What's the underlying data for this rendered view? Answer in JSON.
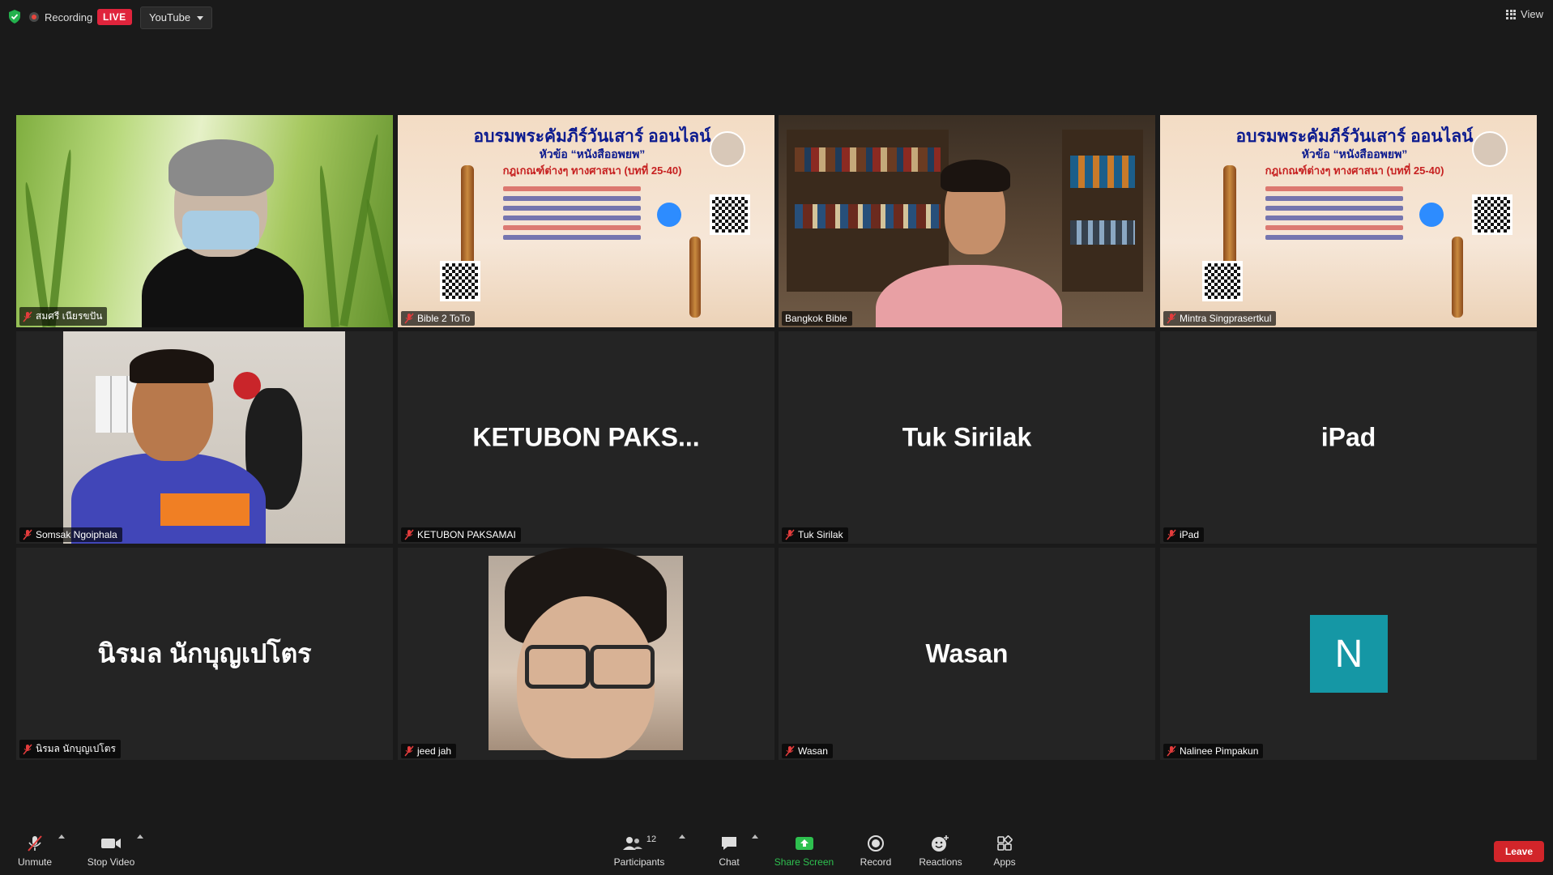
{
  "topbar": {
    "recording_label": "Recording",
    "live_label": "LIVE",
    "stream_target": "YouTube",
    "view_label": "View"
  },
  "tiles": [
    {
      "name": "สมศรี เนียรขปัน",
      "type": "video",
      "muted": true
    },
    {
      "name": "Bible 2 ToTo",
      "type": "share",
      "muted": true
    },
    {
      "name": "Bangkok Bible",
      "type": "video",
      "muted": false,
      "active": true
    },
    {
      "name": "Mintra Singprasertkul",
      "type": "share",
      "muted": true
    },
    {
      "name": "Somsak Ngoiphala",
      "type": "video",
      "muted": true
    },
    {
      "name": "KETUBON PAKSAMAI",
      "display": "KETUBON  PAKS...",
      "type": "name",
      "muted": true
    },
    {
      "name": "Tuk Sirilak",
      "display": "Tuk Sirilak",
      "type": "name",
      "muted": true
    },
    {
      "name": "iPad",
      "display": "iPad",
      "type": "name",
      "muted": true
    },
    {
      "name": "นิรมล นักบุญเปโตร",
      "display": "นิรมล นักบุญเปโตร",
      "type": "name",
      "muted": true
    },
    {
      "name": "jeed jah",
      "type": "video",
      "muted": true
    },
    {
      "name": "Wasan",
      "display": "Wasan",
      "type": "name",
      "muted": true
    },
    {
      "name": "Nalinee Pimpakun",
      "avatar_letter": "N",
      "type": "avatar",
      "muted": true
    }
  ],
  "poster": {
    "title": "อบรมพระคัมภีร์วันเสาร์ ออนไลน์",
    "subtitle": "หัวข้อ “หนังสืออพยพ”",
    "subtitle2": "กฎเกณฑ์ต่างๆ ทางศาสนา (บทที่ 25-40)"
  },
  "toolbar": {
    "unmute": "Unmute",
    "stop_video": "Stop Video",
    "participants": "Participants",
    "participants_count": "12",
    "chat": "Chat",
    "share_screen": "Share Screen",
    "record": "Record",
    "reactions": "Reactions",
    "apps": "Apps",
    "leave": "Leave"
  },
  "colors": {
    "active_speaker_border": "#d9e021",
    "live": "#e0243c",
    "leave": "#d2252a",
    "share_green": "#2ec04f",
    "avatar_bg": "#1597a5"
  }
}
